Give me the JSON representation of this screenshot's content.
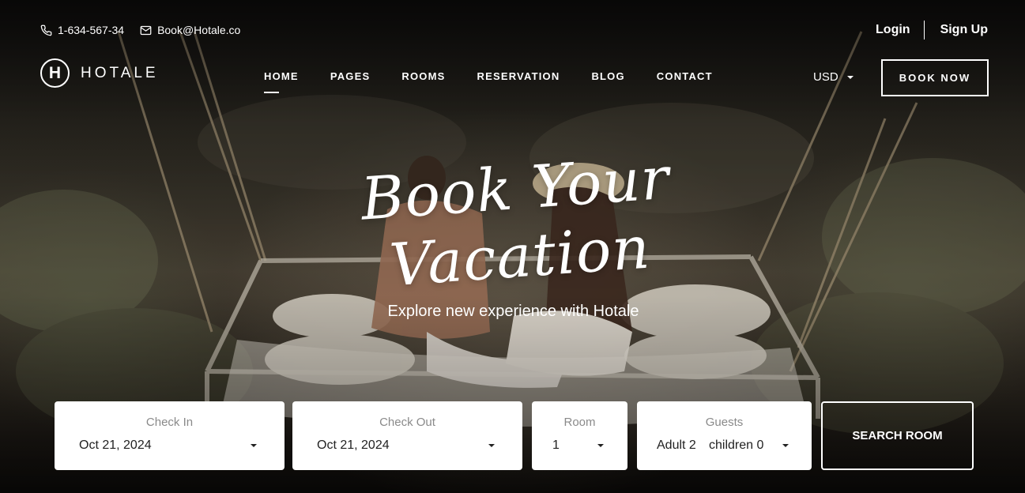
{
  "topbar": {
    "phone": "1-634-567-34",
    "email": "Book@Hotale.co",
    "login": "Login",
    "signup": "Sign Up"
  },
  "brand": {
    "mark": "H",
    "name": "HOTALE"
  },
  "nav": {
    "items": [
      {
        "label": "HOME",
        "active": true
      },
      {
        "label": "PAGES"
      },
      {
        "label": "ROOMS"
      },
      {
        "label": "RESERVATION"
      },
      {
        "label": "BLOG"
      },
      {
        "label": "CONTACT"
      }
    ]
  },
  "currency": {
    "selected": "USD"
  },
  "book_now": "BOOK NOW",
  "hero": {
    "headline": "Book Your Vacation",
    "subhead": "Explore new experience with Hotale"
  },
  "booking": {
    "check_in": {
      "label": "Check In",
      "value": "Oct 21, 2024"
    },
    "check_out": {
      "label": "Check Out",
      "value": "Oct 21, 2024"
    },
    "room": {
      "label": "Room",
      "value": "1"
    },
    "guests": {
      "label": "Guests",
      "adults": "Adult 2",
      "children": "children 0"
    },
    "search_label": "SEARCH ROOM"
  },
  "icons": {
    "phone": "phone-icon",
    "email": "mail-icon",
    "caret": "caret-down-icon"
  },
  "colors": {
    "field_bg": "#ffffff",
    "text_dark": "#222222",
    "label_gray": "#8a8a8a"
  }
}
